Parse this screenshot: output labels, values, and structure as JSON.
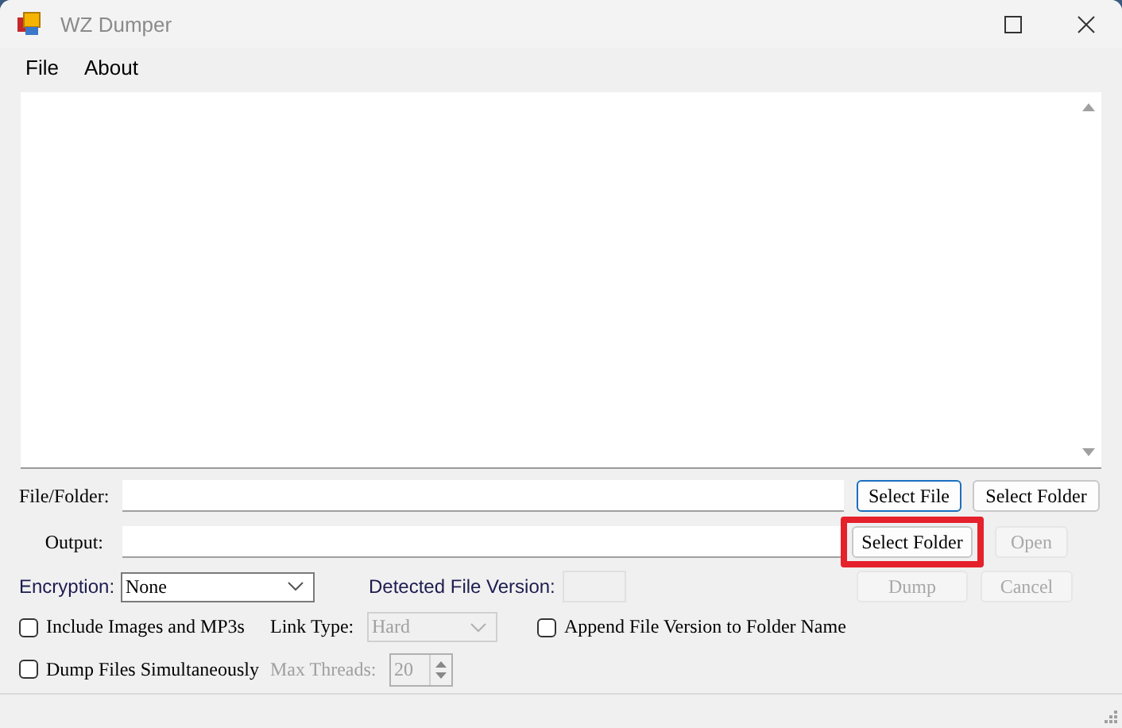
{
  "window": {
    "title": "WZ Dumper"
  },
  "menu": [
    {
      "label": "File"
    },
    {
      "label": "About"
    }
  ],
  "source": {
    "label": "File/Folder:",
    "select_file": {
      "label": "Select File",
      "focused": true,
      "disabled": false
    },
    "select_folder": {
      "label": "Select Folder",
      "disabled": false
    }
  },
  "output": {
    "label": "Output:",
    "select_folder": {
      "label": "Select Folder",
      "highlighted": true,
      "disabled": false
    },
    "open": {
      "label": "Open",
      "disabled": true
    }
  },
  "encryption": {
    "label": "Encryption:",
    "value": "None",
    "disabled": false
  },
  "detected_version": {
    "label": "Detected File Version:"
  },
  "dump": {
    "label": "Dump",
    "disabled": true
  },
  "cancel": {
    "label": "Cancel",
    "disabled": true
  },
  "include_images": {
    "label": "Include Images and MP3s",
    "checked": false
  },
  "link_type": {
    "label": "Link Type:",
    "value": "Hard",
    "disabled": true
  },
  "append_version": {
    "label": "Append File Version to Folder Name",
    "checked": false
  },
  "simultaneous": {
    "label": "Dump Files Simultaneously",
    "checked": false
  },
  "max_threads": {
    "label": "Max Threads:",
    "value": "20",
    "disabled": true
  }
}
